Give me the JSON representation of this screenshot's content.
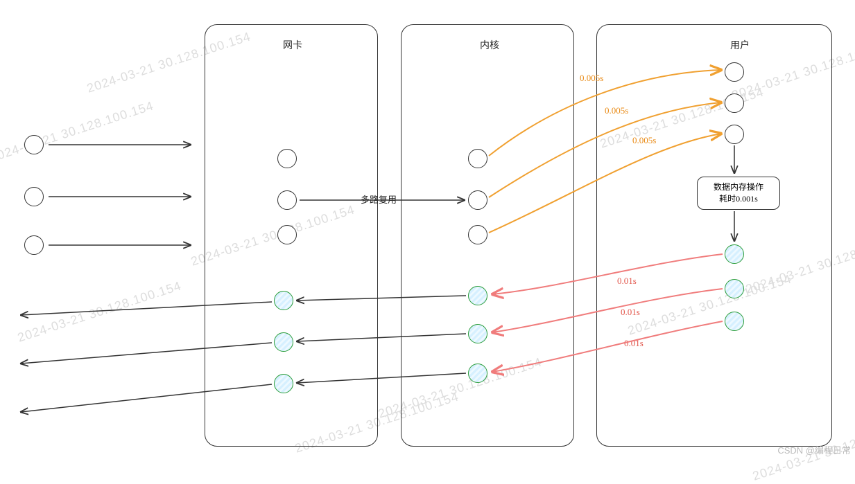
{
  "columns": {
    "nic": {
      "title": "网卡"
    },
    "kernel": {
      "title": "内核"
    },
    "user": {
      "title": "用户"
    }
  },
  "labels": {
    "multiplex": "多路复用",
    "kernel_to_user_1": "0.005s",
    "kernel_to_user_2": "0.005s",
    "kernel_to_user_3": "0.005s",
    "user_to_kernel_1": "0.01s",
    "user_to_kernel_2": "0.01s",
    "user_to_kernel_3": "0.01s"
  },
  "op_box": {
    "line1": "数据内存操作",
    "line2": "耗时0.001s"
  },
  "watermark": "2024-03-21 30.128.100.154",
  "attribution": "CSDN @编程日常"
}
